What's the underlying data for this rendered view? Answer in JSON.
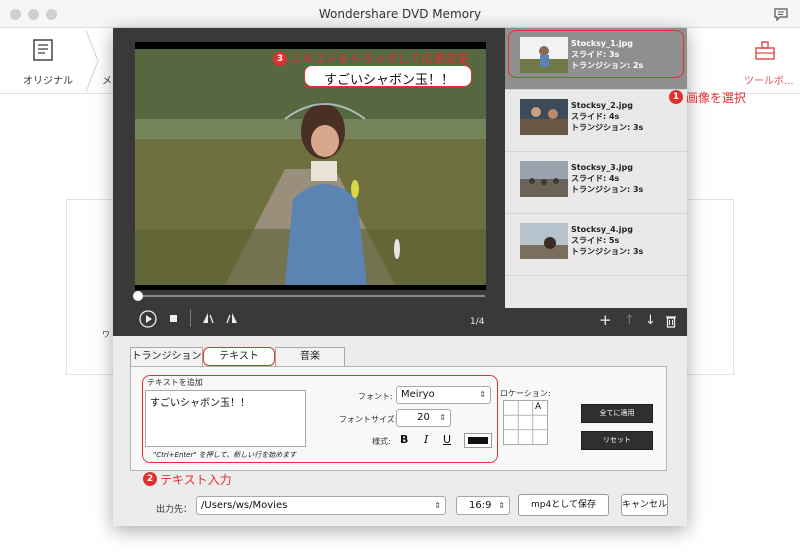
{
  "window": {
    "title": "Wondershare DVD Memory"
  },
  "toolbar": {
    "left_label": "オリジナル",
    "right_label": "ツールボ..."
  },
  "background": {
    "left_stub": "ワ"
  },
  "preview": {
    "overlay_text": "すごいシャボン玉！！",
    "counter": "1/4"
  },
  "slides": [
    {
      "name": "Stocksy_1.jpg",
      "slide": "スライド: 3s",
      "transition": "トランジション: 2s",
      "selected": true
    },
    {
      "name": "Stocksy_2.jpg",
      "slide": "スライド: 4s",
      "transition": "トランジション: 3s",
      "selected": false
    },
    {
      "name": "Stocksy_3.jpg",
      "slide": "スライド: 4s",
      "transition": "トランジション: 3s",
      "selected": false
    },
    {
      "name": "Stocksy_4.jpg",
      "slide": "スライド: 5s",
      "transition": "トランジション: 3s",
      "selected": false
    }
  ],
  "tabs": [
    "トランジション",
    "テキスト",
    "音楽"
  ],
  "text_panel": {
    "group_label": "テキストを追加",
    "text_value": "すごいシャボン玉！！",
    "hint": "\"Ctrl+Enter\" を押して、新しい行を始めます",
    "font_label": "フォント:",
    "font_value": "Meiryo",
    "size_label": "フォントサイズ:",
    "size_value": "20",
    "style_label": "様式:",
    "bold": "B",
    "italic": "I",
    "underline": "U",
    "location_label": "ロケーション:",
    "location_marker": "A",
    "apply_all": "全てに適用",
    "reset": "リセット"
  },
  "footer": {
    "output_label": "出力先：",
    "output_path": "/Users/ws/Movies",
    "ratio": "16:9",
    "save_button": "mp4として保存",
    "cancel_button": "キャンセル"
  },
  "annotations": {
    "a1_num": "1",
    "a1_text": "画像を選択",
    "a2_num": "2",
    "a2_text": "テキスト入力",
    "a3_num": "3",
    "a3_text": "テキストをドラッグして位置変更",
    "color": "#e03030"
  },
  "colors": {
    "dark_panel": "#393939",
    "selected_row": "#8f8f8f",
    "annotation_red": "#e03030"
  }
}
